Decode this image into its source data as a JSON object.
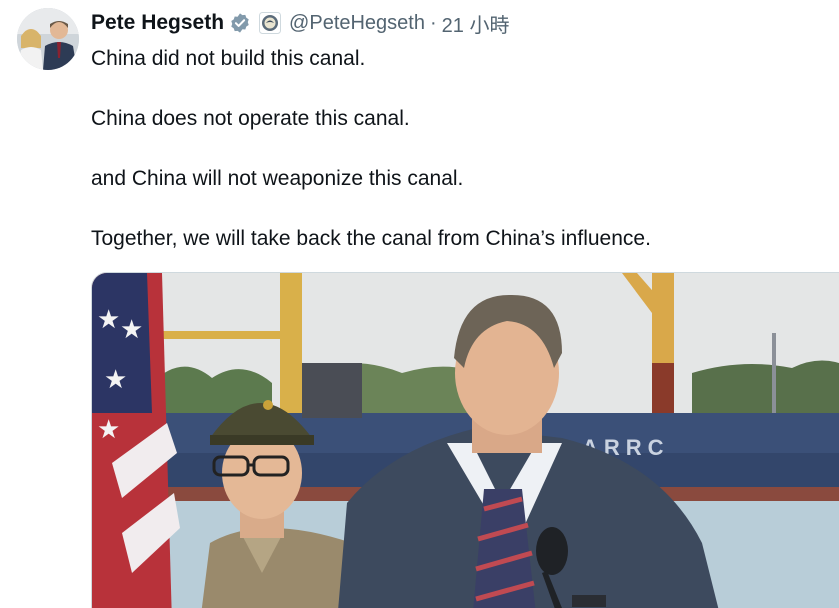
{
  "author": {
    "display_name": "Pete Hegseth",
    "handle": "@PeteHegseth",
    "timestamp": "21 小時",
    "separator": "·",
    "verified_icon": "verified-badge-icon",
    "affiliation_icon": "dod-seal-icon"
  },
  "tweet": {
    "lines": [
      "China did not build this canal.",
      "China does not operate this canal.",
      "and China will not weaponize this canal.",
      "Together, we will take back the canal from China’s influence."
    ]
  },
  "media": {
    "ship_lettering": "ARRC"
  },
  "colors": {
    "text": "#0f1419",
    "secondary": "#536471",
    "verified": "#1d9bf0"
  }
}
